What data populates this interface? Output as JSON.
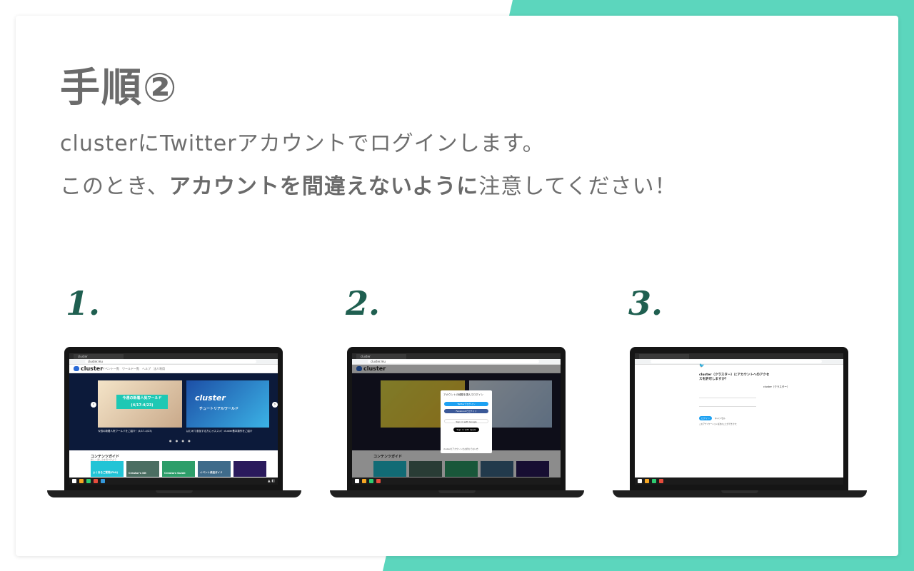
{
  "colors": {
    "accent": "#5cd6bd",
    "text": "#6b6b6b",
    "step_number": "#1f5f50"
  },
  "title": "手順②",
  "lines": {
    "line1": "clusterにTwitterアカウントでログインします。",
    "line2_pre": "このとき、",
    "line2_bold": "アカウントを間違えないように",
    "line2_post": "注意してください！"
  },
  "steps": [
    {
      "number": "1."
    },
    {
      "number": "2."
    },
    {
      "number": "3."
    }
  ],
  "screen1": {
    "tab": "cluster",
    "url": "cluster.mu",
    "logo": "cluster",
    "nav": "イベント一覧　ワールド一覧　ヘルプ　法人利用",
    "banner1_line1": "今週の新着人気ワールド",
    "banner1_line2": "(4/17-4/23)",
    "banner2_title": "cluster",
    "banner2_sub": "チュートリアルワールド",
    "caption1": "今週の新着人気ワールドをご紹介！(4/17-4/23)",
    "caption2": "はじめて参加する方にオススメ！cluster基本操作をご紹介",
    "guide_title": "コンテンツガイド",
    "guide_sub": "新しく楽しみを見つけよう",
    "thumbs": [
      "よくあるご質問(FAQ)",
      "Creator's Kit",
      "Creators Guide",
      "イベント参加ガイド",
      ""
    ]
  },
  "screen2": {
    "modal_title": "アカウントの種類を選んでログイン",
    "btn_twitter": "Twitterでログイン",
    "btn_facebook": "Facebookでログイン",
    "btn_google": "Sign in with Google",
    "btn_apple": "Sign in with Apple",
    "footer": "clusterのアカウントをお持ちでない方"
  },
  "screen3": {
    "title": "cluster（クラスター）にアカウントへのアクセスを許可しますか？",
    "side": "cluster（クラスター）",
    "btn_login": "ログイン",
    "btn_cancel": "キャンセル",
    "text": "このアプリケーションは次のことができます："
  }
}
